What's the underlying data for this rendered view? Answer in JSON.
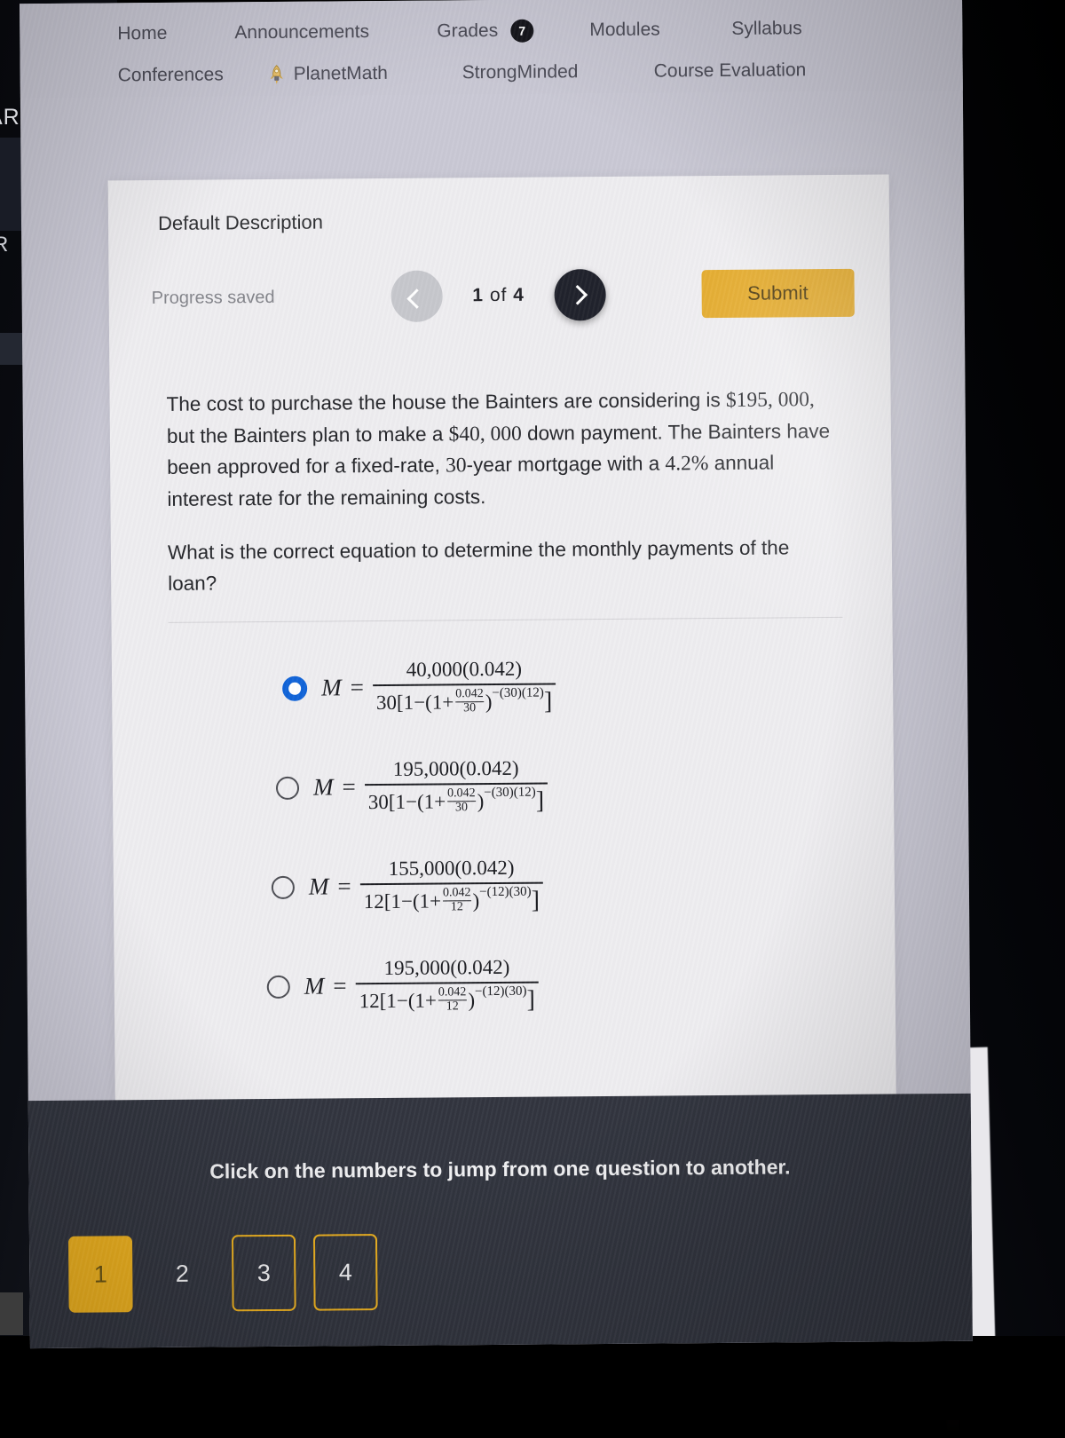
{
  "frame": {
    "left_label_partial": "ARD",
    "left_label_partial2": "R",
    "right_arrow_glyph": "◢"
  },
  "course_nav": {
    "row1": [
      {
        "label": "Home",
        "icon": null,
        "badge": null
      },
      {
        "label": "Announcements",
        "icon": null,
        "badge": null
      },
      {
        "label": "Grades",
        "icon": null,
        "badge": "7"
      },
      {
        "label": "Modules",
        "icon": null,
        "badge": null
      },
      {
        "label": "Syllabus",
        "icon": null,
        "badge": null
      }
    ],
    "row2": [
      {
        "label": "Conferences",
        "icon": null,
        "badge": null
      },
      {
        "label": "PlanetMath",
        "icon": "rocket-icon",
        "badge": null
      },
      {
        "label": "StrongMinded",
        "icon": null,
        "badge": null
      },
      {
        "label": "Course Evaluation",
        "icon": null,
        "badge": null
      }
    ]
  },
  "quiz": {
    "title": "Default Description",
    "progress_status": "Progress saved",
    "counter_current": "1",
    "counter_sep": "of",
    "counter_total": "4",
    "prev_label": "Previous question",
    "next_label": "Next question",
    "submit_label": "Submit",
    "question": {
      "paragraph1_a": "The cost to purchase the house the Bainters are considering is ",
      "paragraph1_b": "$195, 000,",
      "paragraph1_c": " but the Bainters plan to make a ",
      "paragraph1_d": "$40, 000",
      "paragraph1_e": " down payment. The Bainters have been approved for a fixed-rate, ",
      "paragraph1_f": "30",
      "paragraph1_g": "-year mortgage with a ",
      "paragraph1_h": "4.2%",
      "paragraph1_i": " annual interest rate for the remaining costs.",
      "paragraph2": "What is the correct equation to determine the monthly payments of the loan?"
    },
    "options": [
      {
        "selected": true,
        "lhs": "M",
        "eq": "=",
        "numerator": "40,000(0.042)",
        "den_prefix": "30[1−(1+",
        "den_frac_num": "0.042",
        "den_frac_den": "30",
        "den_mid": ")",
        "den_exp": "−(30)(12)",
        "den_suffix": "]"
      },
      {
        "selected": false,
        "lhs": "M",
        "eq": "=",
        "numerator": "195,000(0.042)",
        "den_prefix": "30[1−(1+",
        "den_frac_num": "0.042",
        "den_frac_den": "30",
        "den_mid": ")",
        "den_exp": "−(30)(12)",
        "den_suffix": "]"
      },
      {
        "selected": false,
        "lhs": "M",
        "eq": "=",
        "numerator": "155,000(0.042)",
        "den_prefix": "12[1−(1+",
        "den_frac_num": "0.042",
        "den_frac_den": "12",
        "den_mid": ")",
        "den_exp": "−(12)(30)",
        "den_suffix": "]"
      },
      {
        "selected": false,
        "lhs": "M",
        "eq": "=",
        "numerator": "195,000(0.042)",
        "den_prefix": "12[1−(1+",
        "den_frac_num": "0.042",
        "den_frac_den": "12",
        "den_mid": ")",
        "den_exp": "−(12)(30)",
        "den_suffix": "]"
      }
    ]
  },
  "bottom_bar": {
    "hint": "Click on the numbers to jump from one question to another.",
    "question_numbers": [
      {
        "label": "1",
        "state": "current"
      },
      {
        "label": "2",
        "state": "plain"
      },
      {
        "label": "3",
        "state": "outlined"
      },
      {
        "label": "4",
        "state": "outlined"
      }
    ]
  },
  "colors": {
    "accent_amber": "#e3a825",
    "amber_bright": "#efb21f",
    "selected_radio_blue": "#1164d8",
    "dark_bar": "#32353f",
    "page_bg": "#c9c8d4",
    "card_bg": "#eeedf0"
  }
}
